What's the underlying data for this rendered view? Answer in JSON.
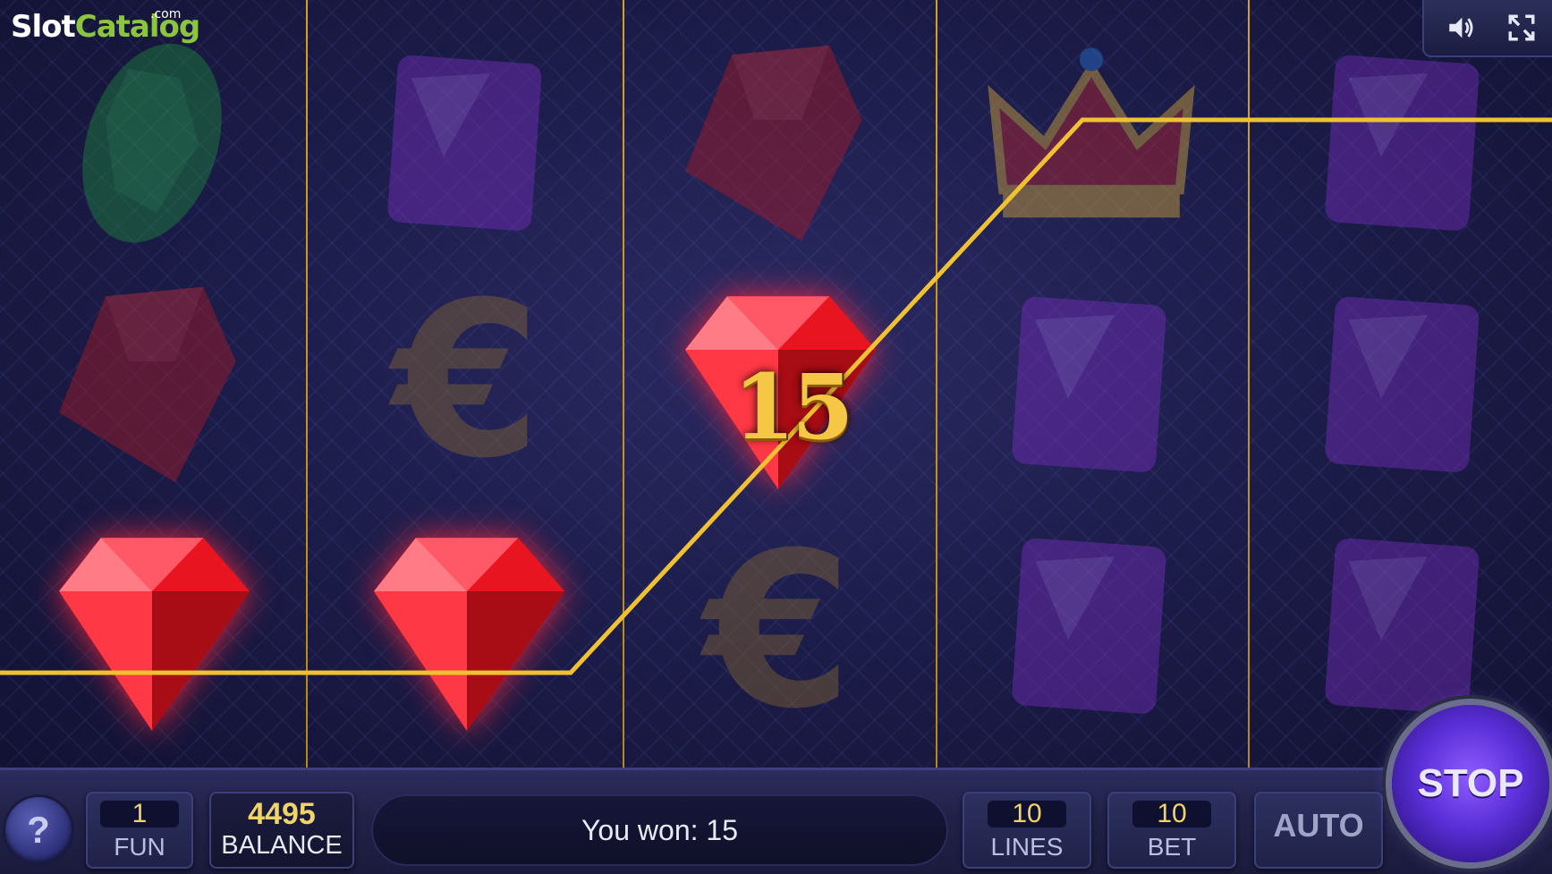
{
  "logo": {
    "slot": "Slot",
    "catalog": "Catalog",
    "com": ".com"
  },
  "top_controls": {
    "sound_icon": "speaker-icon",
    "fullscreen_icon": "fullscreen-icon"
  },
  "reels": [
    [
      "emerald",
      "ruby",
      "ruby"
    ],
    [
      "amethyst",
      "euro",
      "ruby"
    ],
    [
      "ruby",
      "ruby",
      "euro"
    ],
    [
      "crown",
      "amethyst",
      "amethyst"
    ],
    [
      "amethyst",
      "amethyst",
      "amethyst"
    ]
  ],
  "winning_symbols": [
    "0-2",
    "1-2",
    "2-1"
  ],
  "win_amount": "15",
  "bottom_bar": {
    "help_label": "?",
    "coin_value": "1",
    "coin_label": "FUN",
    "balance_value": "4495",
    "balance_label": "BALANCE",
    "message": "You won: 15",
    "lines_value": "10",
    "lines_label": "LINES",
    "bet_value": "10",
    "bet_label": "BET",
    "auto_label": "AUTO",
    "stop_label": "STOP"
  },
  "colors": {
    "payline": "#f0c232",
    "reel_divider": "#d4a21e",
    "gold_text": "#f6c744",
    "stop_button": "#5a2fd8"
  }
}
